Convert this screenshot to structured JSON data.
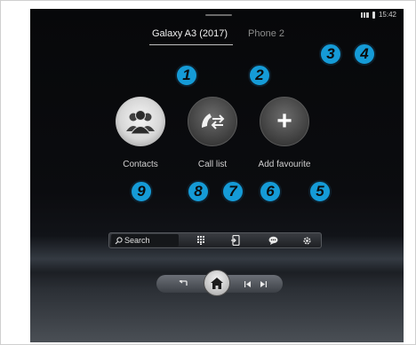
{
  "devices": {
    "primary": "Galaxy A3 (2017)",
    "secondary": "Phone 2"
  },
  "status_bar": {
    "time": "15:42",
    "signal_icon": "signal-strength-icon",
    "battery_icon": "battery-icon"
  },
  "tiles": [
    {
      "label": "Contacts",
      "icon": "contacts-icon"
    },
    {
      "label": "Call list",
      "icon": "call-list-icon"
    },
    {
      "label": "Add favourite",
      "icon": "plus-icon",
      "glyph": "+"
    }
  ],
  "toolbar": {
    "search_label": "Search",
    "icons": [
      "keypad-icon",
      "phone-transfer-icon",
      "message-icon",
      "settings-icon"
    ]
  },
  "callouts": [
    "1",
    "2",
    "3",
    "4",
    "5",
    "6",
    "7",
    "8",
    "9"
  ],
  "navigation": {
    "icons": [
      "back-icon",
      "home-icon",
      "previous-track-icon",
      "next-track-icon"
    ]
  },
  "colors": {
    "callout_blue": "#159bd7",
    "screen_background": "#0b0c0f"
  }
}
